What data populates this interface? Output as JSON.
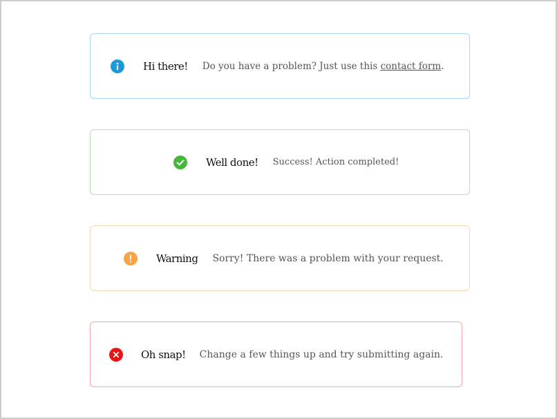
{
  "alerts": {
    "info": {
      "icon": "info-icon",
      "color": "#1a9bd7",
      "border_color": "#a9d8ee",
      "title": "Hi there!",
      "message_before_link": "Do you have a problem? Just use this ",
      "link_text": "contact form",
      "message_after_link": "."
    },
    "success": {
      "icon": "check-icon",
      "color": "#45b83a",
      "border_color": "#b5e3a6",
      "title": "Well done!",
      "message": "Success! Action completed!"
    },
    "warning": {
      "icon": "exclamation-icon",
      "color": "#f5a44a",
      "border_color": "#f8d6b1",
      "title": "Warning",
      "message": "Sorry! There was a problem with your request."
    },
    "error": {
      "icon": "close-icon",
      "color": "#e81515",
      "border_color": "#f2a8aa",
      "title": "Oh snap!",
      "message": "Change a few things up and try submitting again."
    }
  }
}
